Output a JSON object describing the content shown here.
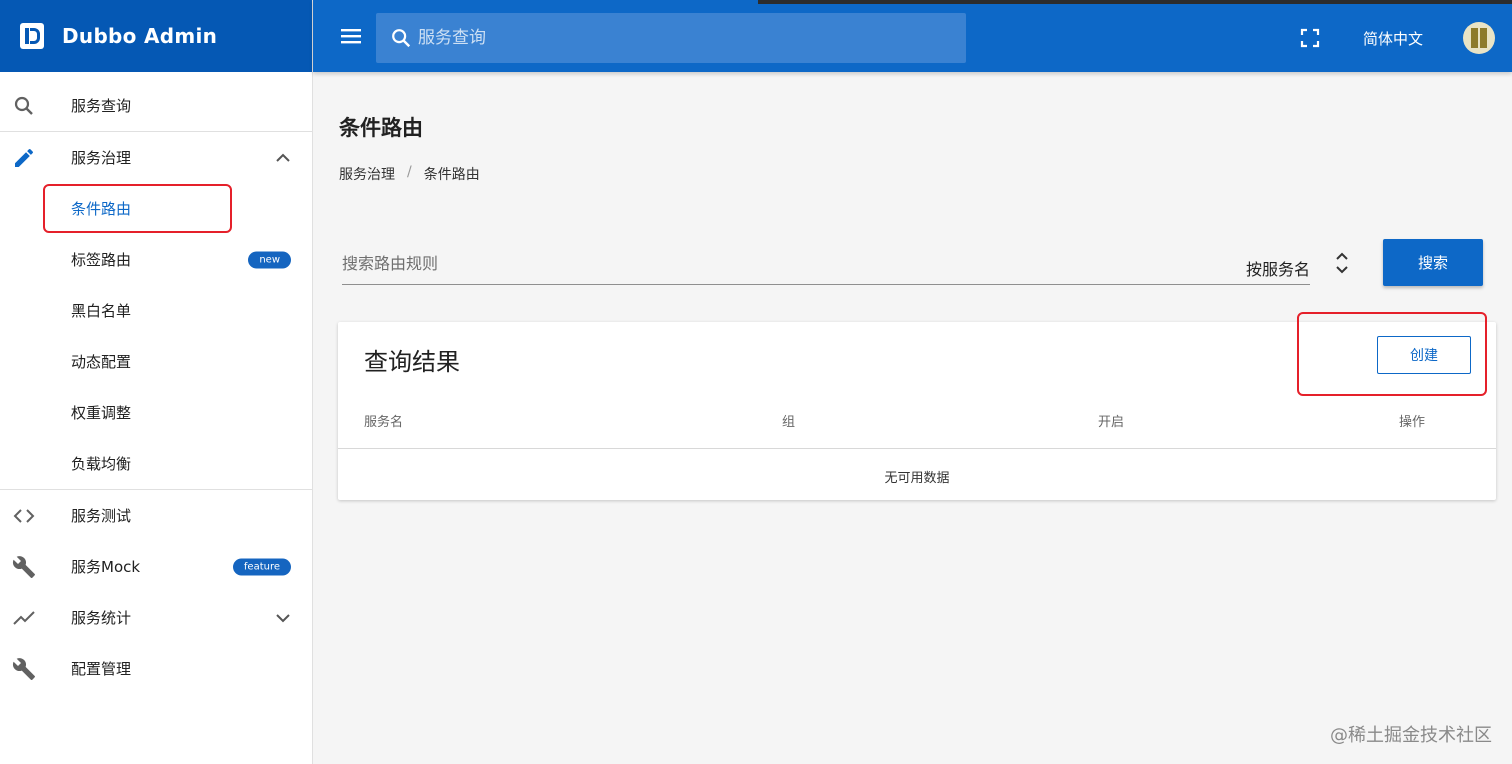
{
  "brand": {
    "name": "Dubbo Admin"
  },
  "topbar": {
    "search_placeholder": "服务查询",
    "language": "简体中文"
  },
  "sidebar": {
    "items": [
      {
        "label": "服务查询",
        "icon": "search-icon"
      },
      {
        "label": "服务治理",
        "icon": "pencil-icon"
      },
      {
        "label": "条件路由"
      },
      {
        "label": "标签路由",
        "badge": "new"
      },
      {
        "label": "黑白名单"
      },
      {
        "label": "动态配置"
      },
      {
        "label": "权重调整"
      },
      {
        "label": "负载均衡"
      },
      {
        "label": "服务测试",
        "icon": "code-icon"
      },
      {
        "label": "服务Mock",
        "icon": "wrench-icon",
        "badge": "feature"
      },
      {
        "label": "服务统计",
        "icon": "trending-icon"
      },
      {
        "label": "配置管理",
        "icon": "wrench-icon"
      }
    ]
  },
  "main": {
    "title": "条件路由",
    "breadcrumb": [
      "服务治理",
      "/",
      "条件路由"
    ],
    "filter_placeholder": "搜索路由规则",
    "filter_select": "按服务名",
    "search_button": "搜索",
    "card": {
      "title": "查询结果",
      "create_button": "创建",
      "columns": [
        "服务名",
        "组",
        "开启",
        "操作"
      ],
      "empty_text": "无可用数据"
    }
  },
  "watermark": "@稀土掘金技术社区",
  "colors": {
    "primary": "#0d68c7",
    "brand_bar": "#0558b4",
    "highlight": "#e5202a"
  }
}
